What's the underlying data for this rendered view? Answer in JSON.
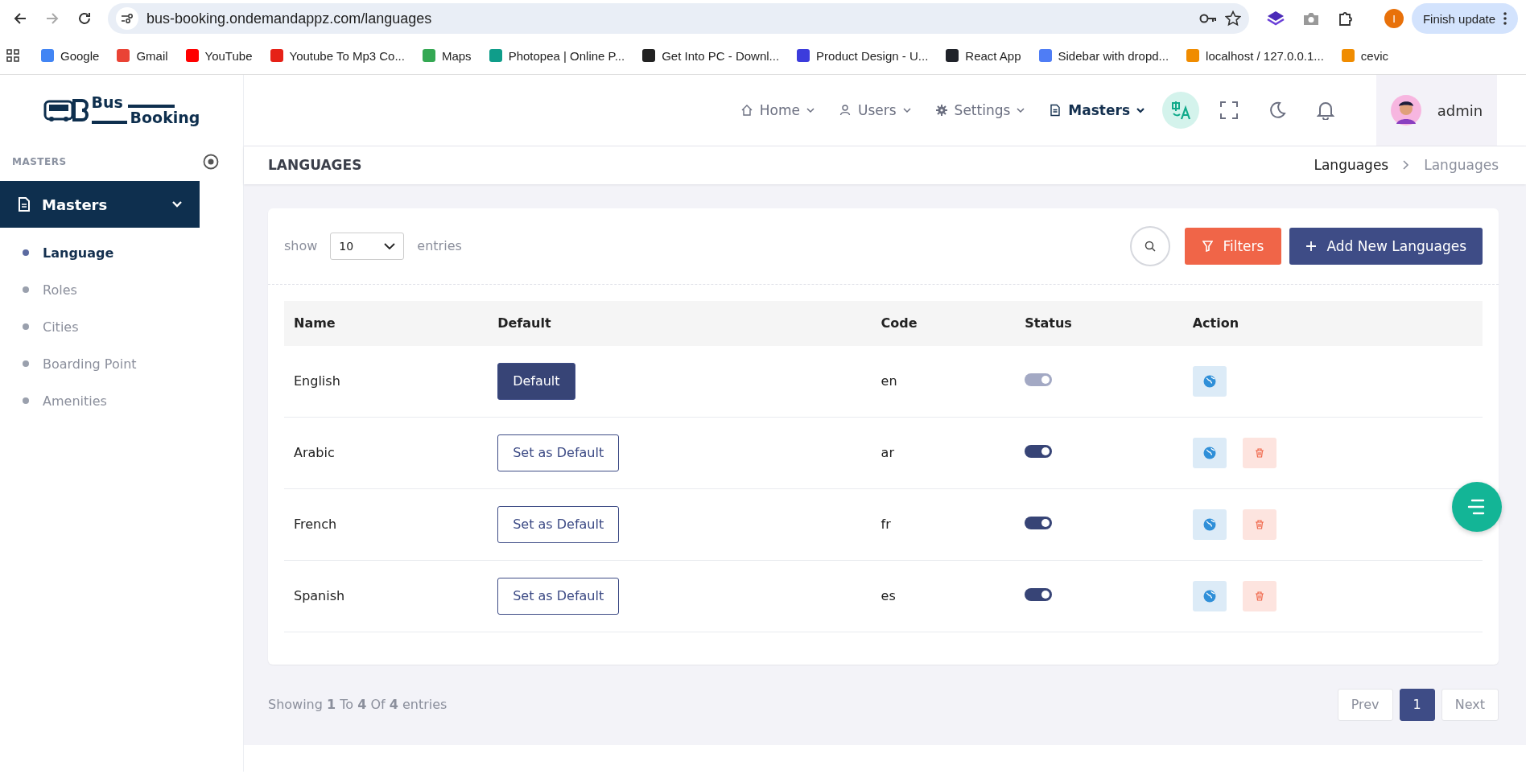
{
  "browser": {
    "url": "bus-booking.ondemandappz.com/languages",
    "update_button": "Finish update",
    "profile_initial": "I",
    "bookmarks": [
      "Google",
      "Gmail",
      "YouTube",
      "Youtube To Mp3 Co...",
      "Maps",
      "Photopea | Online P...",
      "Get Into PC - Downl...",
      "Product Design - U...",
      "React App",
      "Sidebar with dropd...",
      "localhost / 127.0.0.1...",
      "cevic"
    ]
  },
  "logo": {
    "word_1": "Bus",
    "word_2": "Booking"
  },
  "sidebar": {
    "section_title": "MASTERS",
    "menu": {
      "label": "Masters",
      "expanded": true,
      "items": [
        {
          "label": "Language",
          "selected": true
        },
        {
          "label": "Roles",
          "selected": false
        },
        {
          "label": "Cities",
          "selected": false
        },
        {
          "label": "Boarding Point",
          "selected": false
        },
        {
          "label": "Amenities",
          "selected": false
        }
      ]
    }
  },
  "topnav": {
    "items": [
      {
        "label": "Home",
        "kind": "home",
        "selected": false
      },
      {
        "label": "Users",
        "kind": "user",
        "selected": false
      },
      {
        "label": "Settings",
        "kind": "gear",
        "selected": false
      },
      {
        "label": "Masters",
        "kind": "doc",
        "selected": true
      }
    ],
    "user": "admin"
  },
  "page": {
    "title": "LANGUAGES",
    "breadcrumb": [
      "Languages",
      "Languages"
    ]
  },
  "toolbar": {
    "show_label": "show",
    "page_size": "10",
    "entries_label": "entries",
    "filters_button": "Filters",
    "add_button": "Add New Languages"
  },
  "table": {
    "columns": [
      "Name",
      "Default",
      "Code",
      "Status",
      "Action"
    ],
    "rows": [
      {
        "name": "English",
        "default_button": "Default",
        "selected": true,
        "code": "en",
        "on": true,
        "disabled": true,
        "deletable": false
      },
      {
        "name": "Arabic",
        "default_button": "Set as Default",
        "selected": false,
        "code": "ar",
        "on": true,
        "disabled": false,
        "deletable": true
      },
      {
        "name": "French",
        "default_button": "Set as Default",
        "selected": false,
        "code": "fr",
        "on": true,
        "disabled": false,
        "deletable": true
      },
      {
        "name": "Spanish",
        "default_button": "Set as Default",
        "selected": false,
        "code": "es",
        "on": true,
        "disabled": false,
        "deletable": true
      }
    ]
  },
  "pagination": {
    "summary": "Showing **1** To **4** Of **4** entries",
    "prev": "Prev",
    "pages": [
      {
        "label": "1",
        "selected": true
      }
    ],
    "next": "Next"
  }
}
